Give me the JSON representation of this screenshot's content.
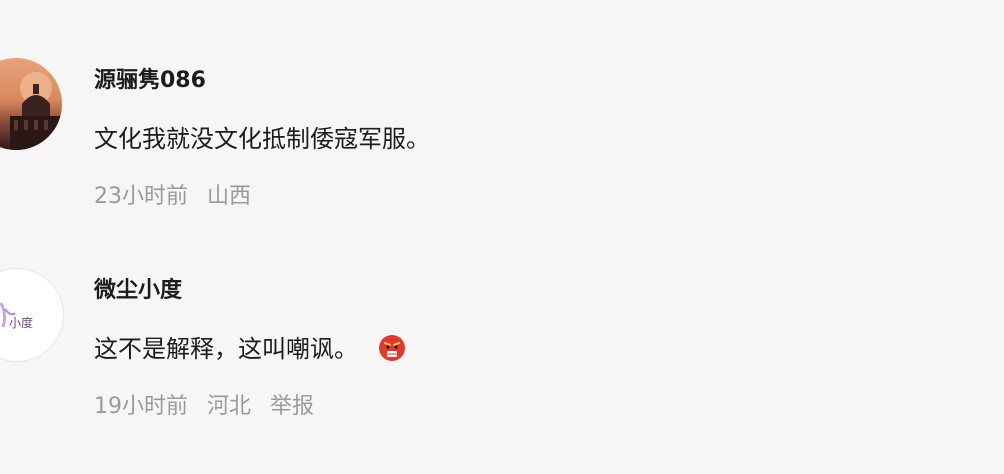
{
  "comments": [
    {
      "username": "源骊隽086",
      "text": "文化我就没文化抵制倭寇军服。",
      "time": "23小时前",
      "location": "山西"
    },
    {
      "username": "微尘小度",
      "avatar_text": "小度",
      "text": "这不是解释，这叫嘲讽。",
      "emoji": "angry-face-icon",
      "time": "19小时前",
      "location": "河北",
      "report_label": "举报"
    }
  ]
}
